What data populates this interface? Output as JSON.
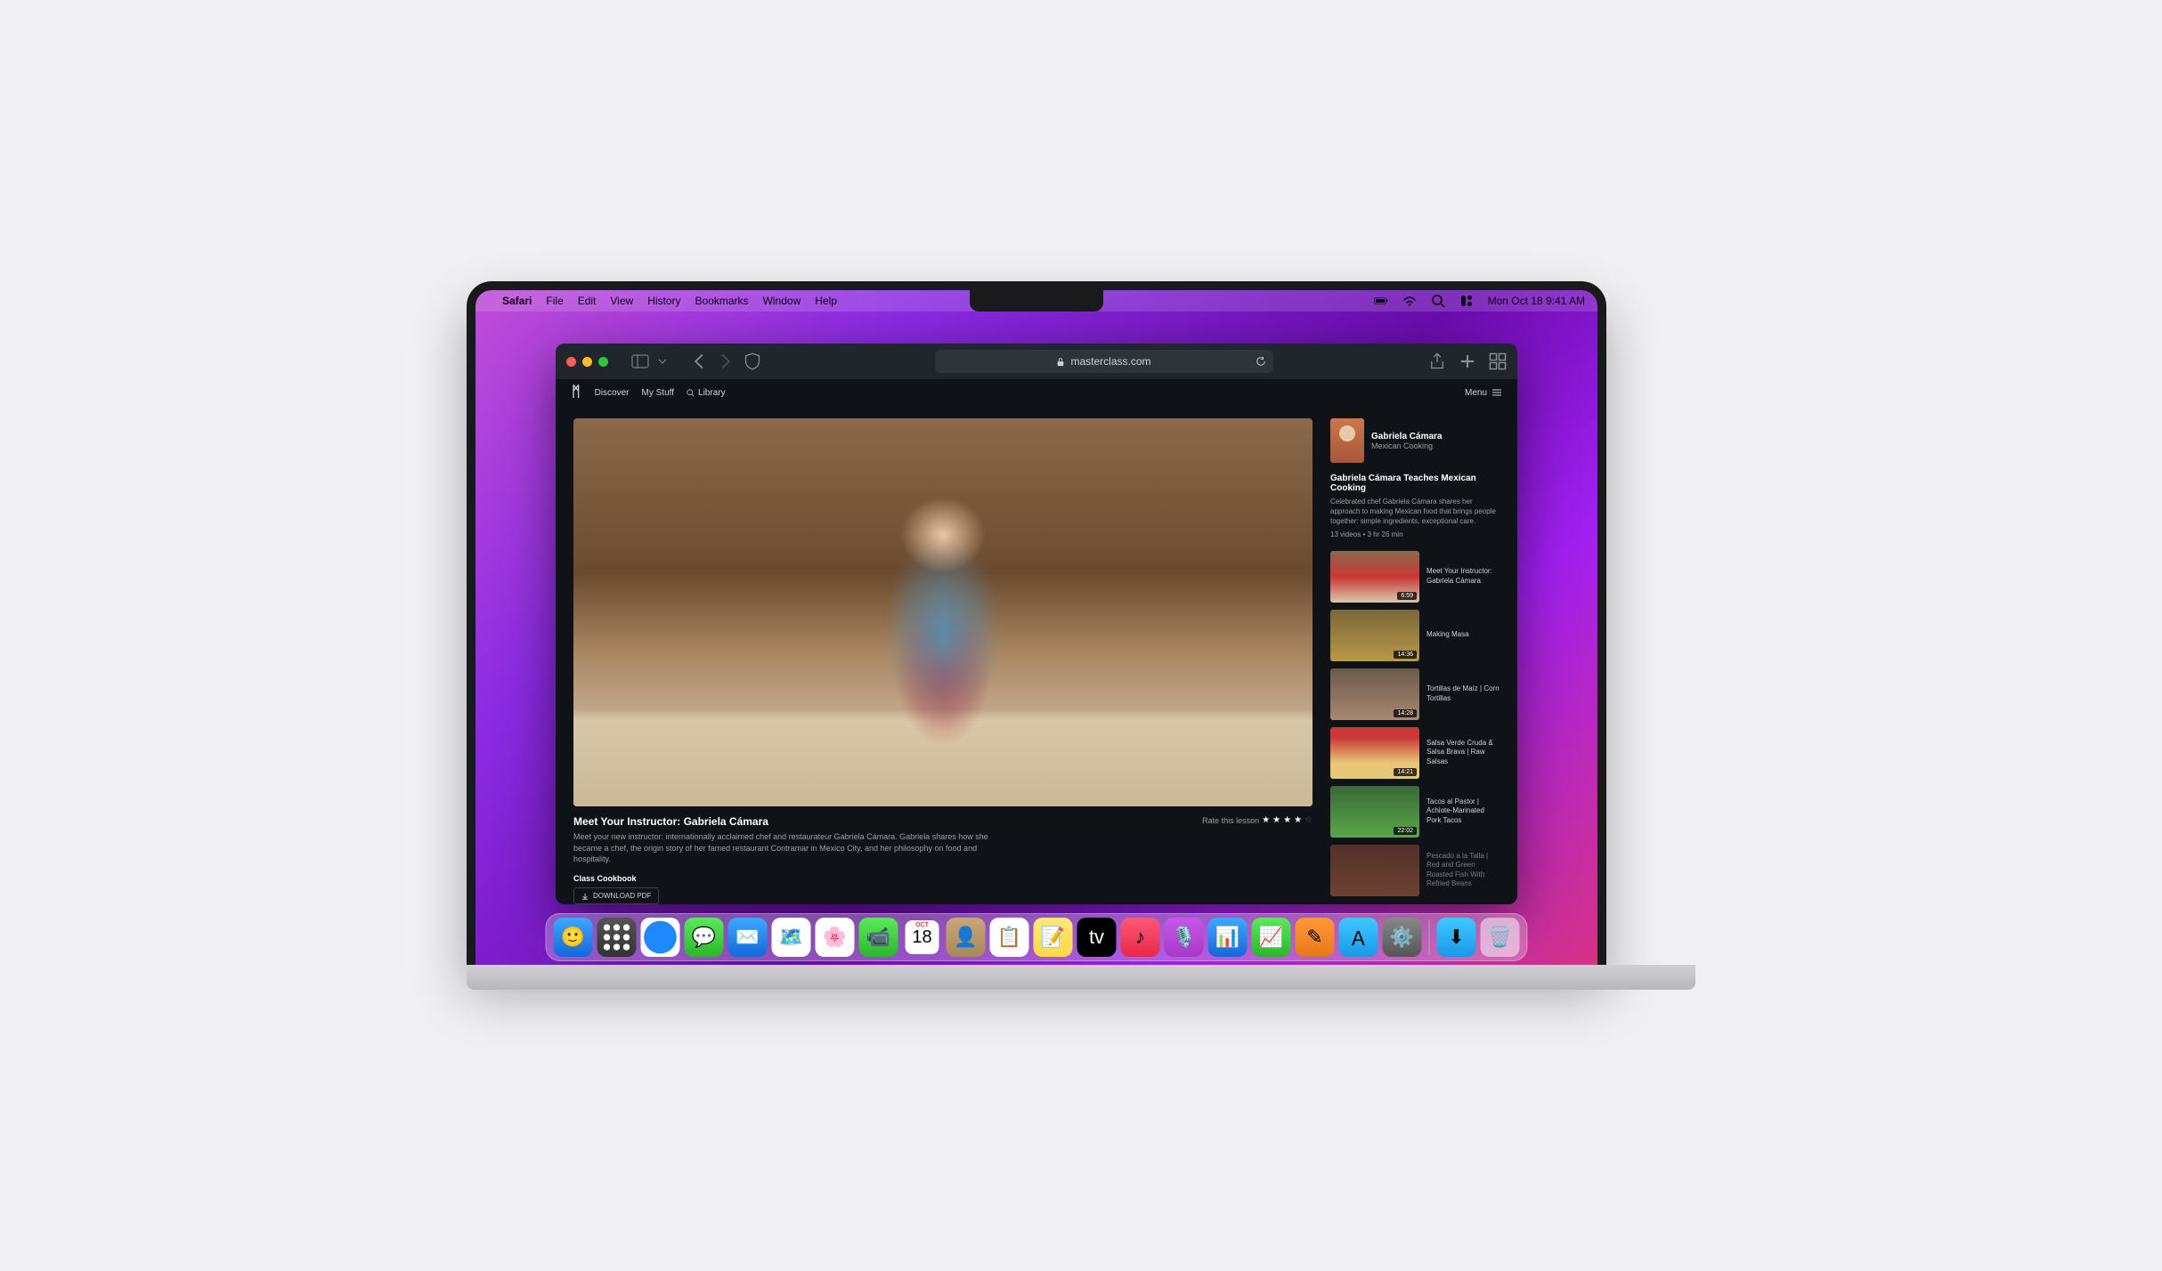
{
  "menubar": {
    "app": "Safari",
    "items": [
      "File",
      "Edit",
      "View",
      "History",
      "Bookmarks",
      "Window",
      "Help"
    ],
    "datetime": "Mon Oct 18  9:41 AM"
  },
  "safari": {
    "url_host": "masterclass.com"
  },
  "mc": {
    "nav": {
      "discover": "Discover",
      "mystuff": "My Stuff",
      "library": "Library",
      "menu": "Menu"
    },
    "instructor": {
      "name": "Gabriela Cámara",
      "subtitle": "Mexican Cooking"
    },
    "course": {
      "title": "Gabriela Cámara Teaches Mexican Cooking",
      "desc": "Celebrated chef Gabriela Cámara shares her approach to making Mexican food that brings people together: simple ingredients, exceptional care.",
      "stats": "13 videos • 3 hr 26 min"
    },
    "lesson": {
      "title": "Meet Your Instructor: Gabriela Cámara",
      "desc": "Meet your new instructor: internationally acclaimed chef and restaurateur Gabriela Cámara. Gabriela shares how she became a chef, the origin story of her famed restaurant Contramar in Mexico City, and her philosophy on food and hospitality.",
      "cookbook": "Class Cookbook",
      "download": "DOWNLOAD PDF",
      "rate_label": "Rate this lesson"
    },
    "playlist": [
      {
        "title": "Meet Your Instructor: Gabriela Cámara",
        "dur": "6:59"
      },
      {
        "title": "Making Masa",
        "dur": "14:36"
      },
      {
        "title": "Tortillas de Maíz | Corn Tortillas",
        "dur": "14:28"
      },
      {
        "title": "Salsa Verde Cruda & Salsa Brava | Raw Salsas",
        "dur": "14:21"
      },
      {
        "title": "Tacos al Pastor | Achiote-Marinated Pork Tacos",
        "dur": "22:02"
      },
      {
        "title": "Pescado a la Talla | Red and Green Roasted Fish With Refried Beans",
        "dur": ""
      }
    ]
  },
  "dock": {
    "calendar": {
      "month": "OCT",
      "day": "18"
    }
  }
}
